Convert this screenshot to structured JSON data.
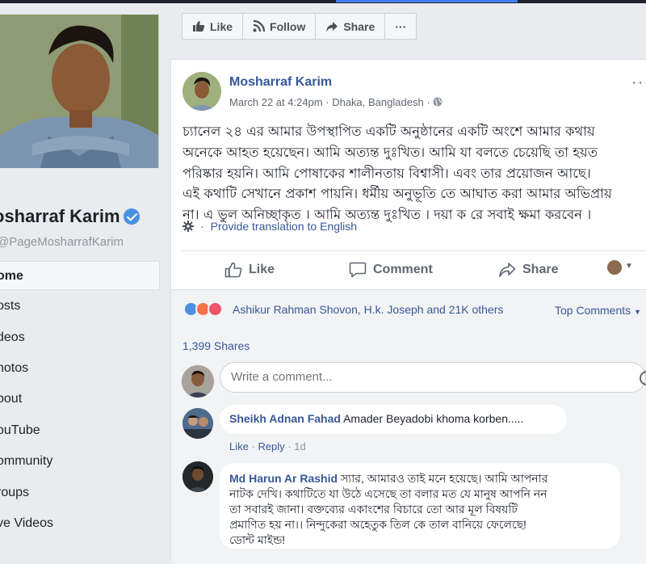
{
  "page": {
    "name": "osharraf Karim",
    "handle": "PageMosharrafKarim",
    "nav": [
      "ome",
      "osts",
      "deos",
      "hotos",
      "bout",
      "ouTube",
      "ommunity",
      "roups",
      "ve Videos"
    ]
  },
  "actionbar": {
    "like": "Like",
    "follow": "Follow",
    "share": "Share",
    "more": "···"
  },
  "post": {
    "author": "Mosharraf Karim",
    "date": "March 22 at 4:24pm",
    "location": "Dhaka, Bangladesh",
    "text_lines": [
      "চ্যানেল ২৪ এর আমার উপস্থাপিত একটি অনুষ্ঠানের একটি অংশে আমার কথায়",
      "অনেকে আহত হয়েছেন। আমি অত্যন্ত দুঃখিত। আমি যা বলতে চেয়েছি তা হয়ত",
      "পরিষ্কার হয়নি। আমি পোষাকের শালীনতায় বিশ্বাসী। এবং তার প্রয়োজন আছে।",
      "এই কথাটি সেখানে প্রকাশ পায়নি। ধর্মীয় অনুভূতি তে আঘাত করা আমার অভিপ্রায়",
      "না। এ ভুল অনিচ্ছাকৃত । আমি অত্যন্ত দুঃখিত । দয়া ক রে সবাই ক্ষমা করবেন ।"
    ],
    "translate": "Provide translation to English",
    "like": "Like",
    "comment": "Comment",
    "share": "Share"
  },
  "feedback": {
    "reactors": "Ashikur Rahman Shovon, H.k. Joseph and 21K others",
    "top_comments": "Top Comments",
    "shares": "1,399 Shares",
    "placeholder": "Write a comment..."
  },
  "comments": [
    {
      "name": "Sheikh Adnan Fahad",
      "text": "Amader Beyadobi khoma korben.....",
      "like": "Like",
      "reply": "Reply",
      "time": "1d"
    },
    {
      "name": "Md Harun Ar Rashid",
      "lines": [
        "স্যার, আমারও তাই মনে হয়েছে। আমি আপনার",
        "নাটক দেখি। কথাটিতে যা উঠে এসেছে তা বলার মত যে মানুষ আপনি নন",
        "তা সবারই জানা। বক্তব্যের একাংশের বিচারে তো আর মূল বিষয়টি",
        "প্রমাণিত হয় না।। নিন্দুকেরা অহেতুক তিল কে তাল বানিয়ে ফেলেছে!",
        "ডোন্ট মাইন্ড!"
      ]
    }
  ],
  "colors": {
    "link": "#385898",
    "name": "#365899",
    "like_blue": "#4a90e2",
    "angry": "#f7714c",
    "love": "#f25268"
  }
}
